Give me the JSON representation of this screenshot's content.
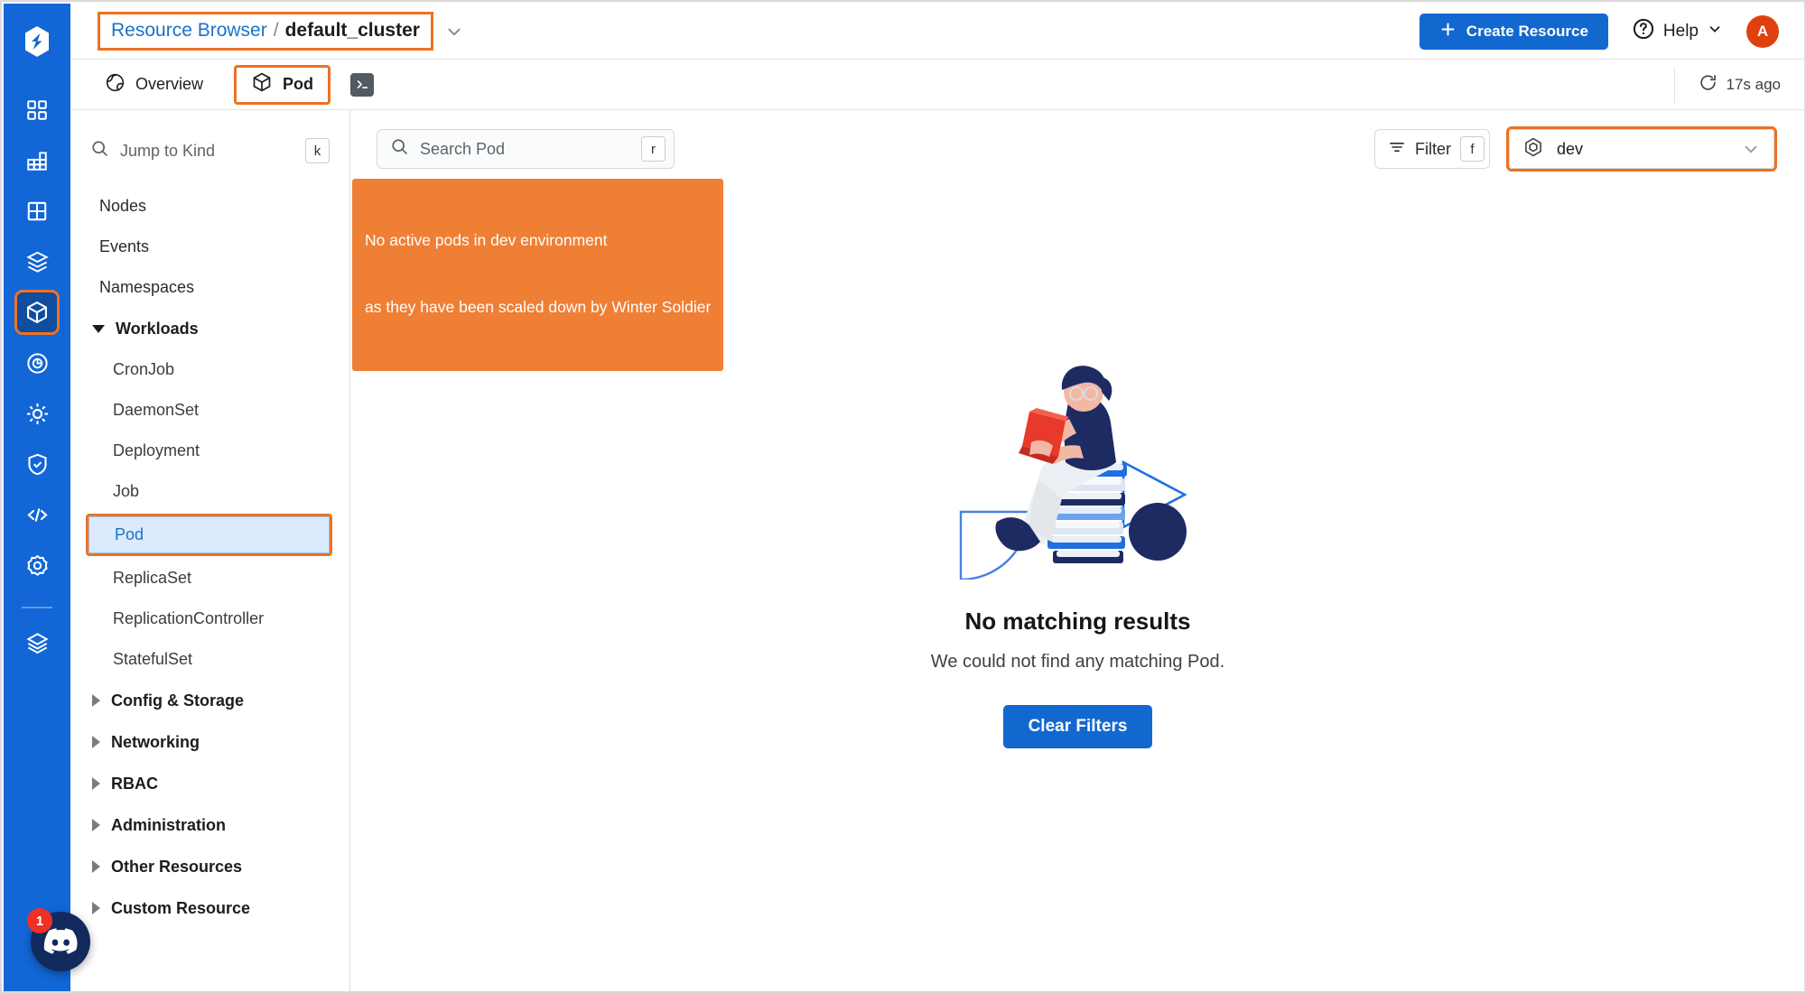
{
  "rail": {
    "logo_icon": "app-logo-icon",
    "items": [
      {
        "icon": "grid-dashboard-icon",
        "active": false
      },
      {
        "icon": "bar-chart-grid-icon",
        "active": false
      },
      {
        "icon": "table-grid-icon",
        "active": false
      },
      {
        "icon": "stacked-box-icon",
        "active": false
      },
      {
        "icon": "cube-icon",
        "active": true
      },
      {
        "icon": "target-circle-icon",
        "active": false
      },
      {
        "icon": "sun-gear-icon",
        "active": false
      },
      {
        "icon": "shield-check-icon",
        "active": false
      },
      {
        "icon": "code-brackets-icon",
        "active": false
      },
      {
        "icon": "settings-gear-icon",
        "active": false
      },
      {
        "icon": "layers-icon",
        "active": false
      }
    ],
    "chat": {
      "icon": "discord-icon",
      "badge": "1"
    }
  },
  "header": {
    "breadcrumb": {
      "root": "Resource Browser",
      "separator": "/",
      "current": "default_cluster",
      "chevron_icon": "chevron-down-icon"
    },
    "create_button": {
      "label": "Create Resource",
      "icon": "plus-icon"
    },
    "help": {
      "label": "Help",
      "icon": "question-circle-icon",
      "chevron_icon": "chevron-down-icon"
    },
    "avatar": {
      "initial": "A"
    }
  },
  "tabs": {
    "items": [
      {
        "label": "Overview",
        "icon": "globe-icon",
        "selected": false
      },
      {
        "label": "Pod",
        "icon": "cube-icon",
        "selected": true
      }
    ],
    "terminal": {
      "icon": "terminal-icon"
    },
    "refresh": {
      "icon": "refresh-icon",
      "label": "17s ago"
    }
  },
  "sidebar": {
    "jump": {
      "placeholder": "Jump to Kind",
      "icon": "search-icon",
      "shortcut": "k"
    },
    "items": [
      {
        "label": "Nodes",
        "type": "item"
      },
      {
        "label": "Events",
        "type": "item"
      },
      {
        "label": "Namespaces",
        "type": "item"
      },
      {
        "label": "Workloads",
        "type": "group",
        "expanded": true
      },
      {
        "label": "CronJob",
        "type": "child"
      },
      {
        "label": "DaemonSet",
        "type": "child"
      },
      {
        "label": "Deployment",
        "type": "child"
      },
      {
        "label": "Job",
        "type": "child"
      },
      {
        "label": "Pod",
        "type": "child-selected"
      },
      {
        "label": "ReplicaSet",
        "type": "child"
      },
      {
        "label": "ReplicationController",
        "type": "child"
      },
      {
        "label": "StatefulSet",
        "type": "child"
      },
      {
        "label": "Config & Storage",
        "type": "group",
        "expanded": false
      },
      {
        "label": "Networking",
        "type": "group",
        "expanded": false
      },
      {
        "label": "RBAC",
        "type": "group",
        "expanded": false
      },
      {
        "label": "Administration",
        "type": "group",
        "expanded": false
      },
      {
        "label": "Other Resources",
        "type": "group",
        "expanded": false
      },
      {
        "label": "Custom Resource",
        "type": "group",
        "expanded": false
      }
    ]
  },
  "main": {
    "search": {
      "placeholder": "Search Pod",
      "icon": "search-icon",
      "shortcut": "r"
    },
    "filter": {
      "label": "Filter",
      "icon": "filter-icon",
      "shortcut": "f"
    },
    "namespace": {
      "value": "dev",
      "icon": "namespace-hexagon-icon",
      "chevron_icon": "chevron-down-icon"
    },
    "callout": {
      "line1": "No active pods in dev environment",
      "line2": "as they have been scaled down by Winter Soldier"
    },
    "empty_state": {
      "illustration": "person-reading-on-books-illustration",
      "title": "No matching results",
      "subtitle": "We could not find any matching Pod.",
      "button_label": "Clear Filters"
    }
  },
  "colors": {
    "brand_blue": "#1266d6",
    "accent_orange": "#ee7124",
    "callout_orange": "#ef7f35",
    "link_blue": "#1a73c8",
    "button_blue": "#1268ce",
    "avatar_red": "#e0400f",
    "badge_red": "#ef3124",
    "selected_row_bg": "#dbeafd"
  }
}
